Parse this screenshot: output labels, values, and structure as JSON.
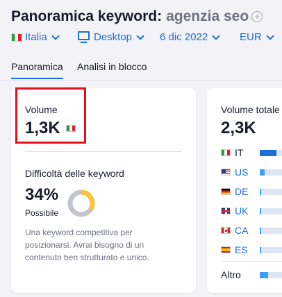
{
  "header": {
    "title": "Panoramica keyword:",
    "keyword": "agenzia seo",
    "add_icon": "plus-circle-icon"
  },
  "filters": {
    "country": "Italia",
    "device": "Desktop",
    "date": "6 dic 2022",
    "currency": "EUR"
  },
  "tabs": [
    {
      "label": "Panoramica",
      "active": true
    },
    {
      "label": "Analisi in blocco",
      "active": false
    }
  ],
  "left_card": {
    "volume_label": "Volume",
    "volume_value": "1,3K",
    "difficulty_label": "Difficoltà delle keyword",
    "difficulty_value": "34%",
    "difficulty_percent": 34,
    "difficulty_text": "Possibile",
    "description": "Una keyword competitiva per posizionarsi. Avrai bisogno di un contenuto ben strutturato e unico."
  },
  "right_card": {
    "label": "Volume totale",
    "value": "2,3K",
    "countries": [
      {
        "code": "IT",
        "flag": "it",
        "share": 0.6
      },
      {
        "code": "US",
        "flag": "us",
        "share": 0.18
      },
      {
        "code": "DE",
        "flag": "de",
        "share": 0.05
      },
      {
        "code": "UK",
        "flag": "uk",
        "share": 0.05
      },
      {
        "code": "CA",
        "flag": "ca",
        "share": 0.05
      },
      {
        "code": "ES",
        "flag": "es",
        "share": 0.05
      }
    ],
    "other_label": "Altro",
    "other_share": 0.3
  },
  "colors": {
    "accent": "#1b6fd8",
    "highlight_box": "#e3111a",
    "difficulty_ring": "#fdc23c",
    "ring_track": "#c4c5cc"
  }
}
